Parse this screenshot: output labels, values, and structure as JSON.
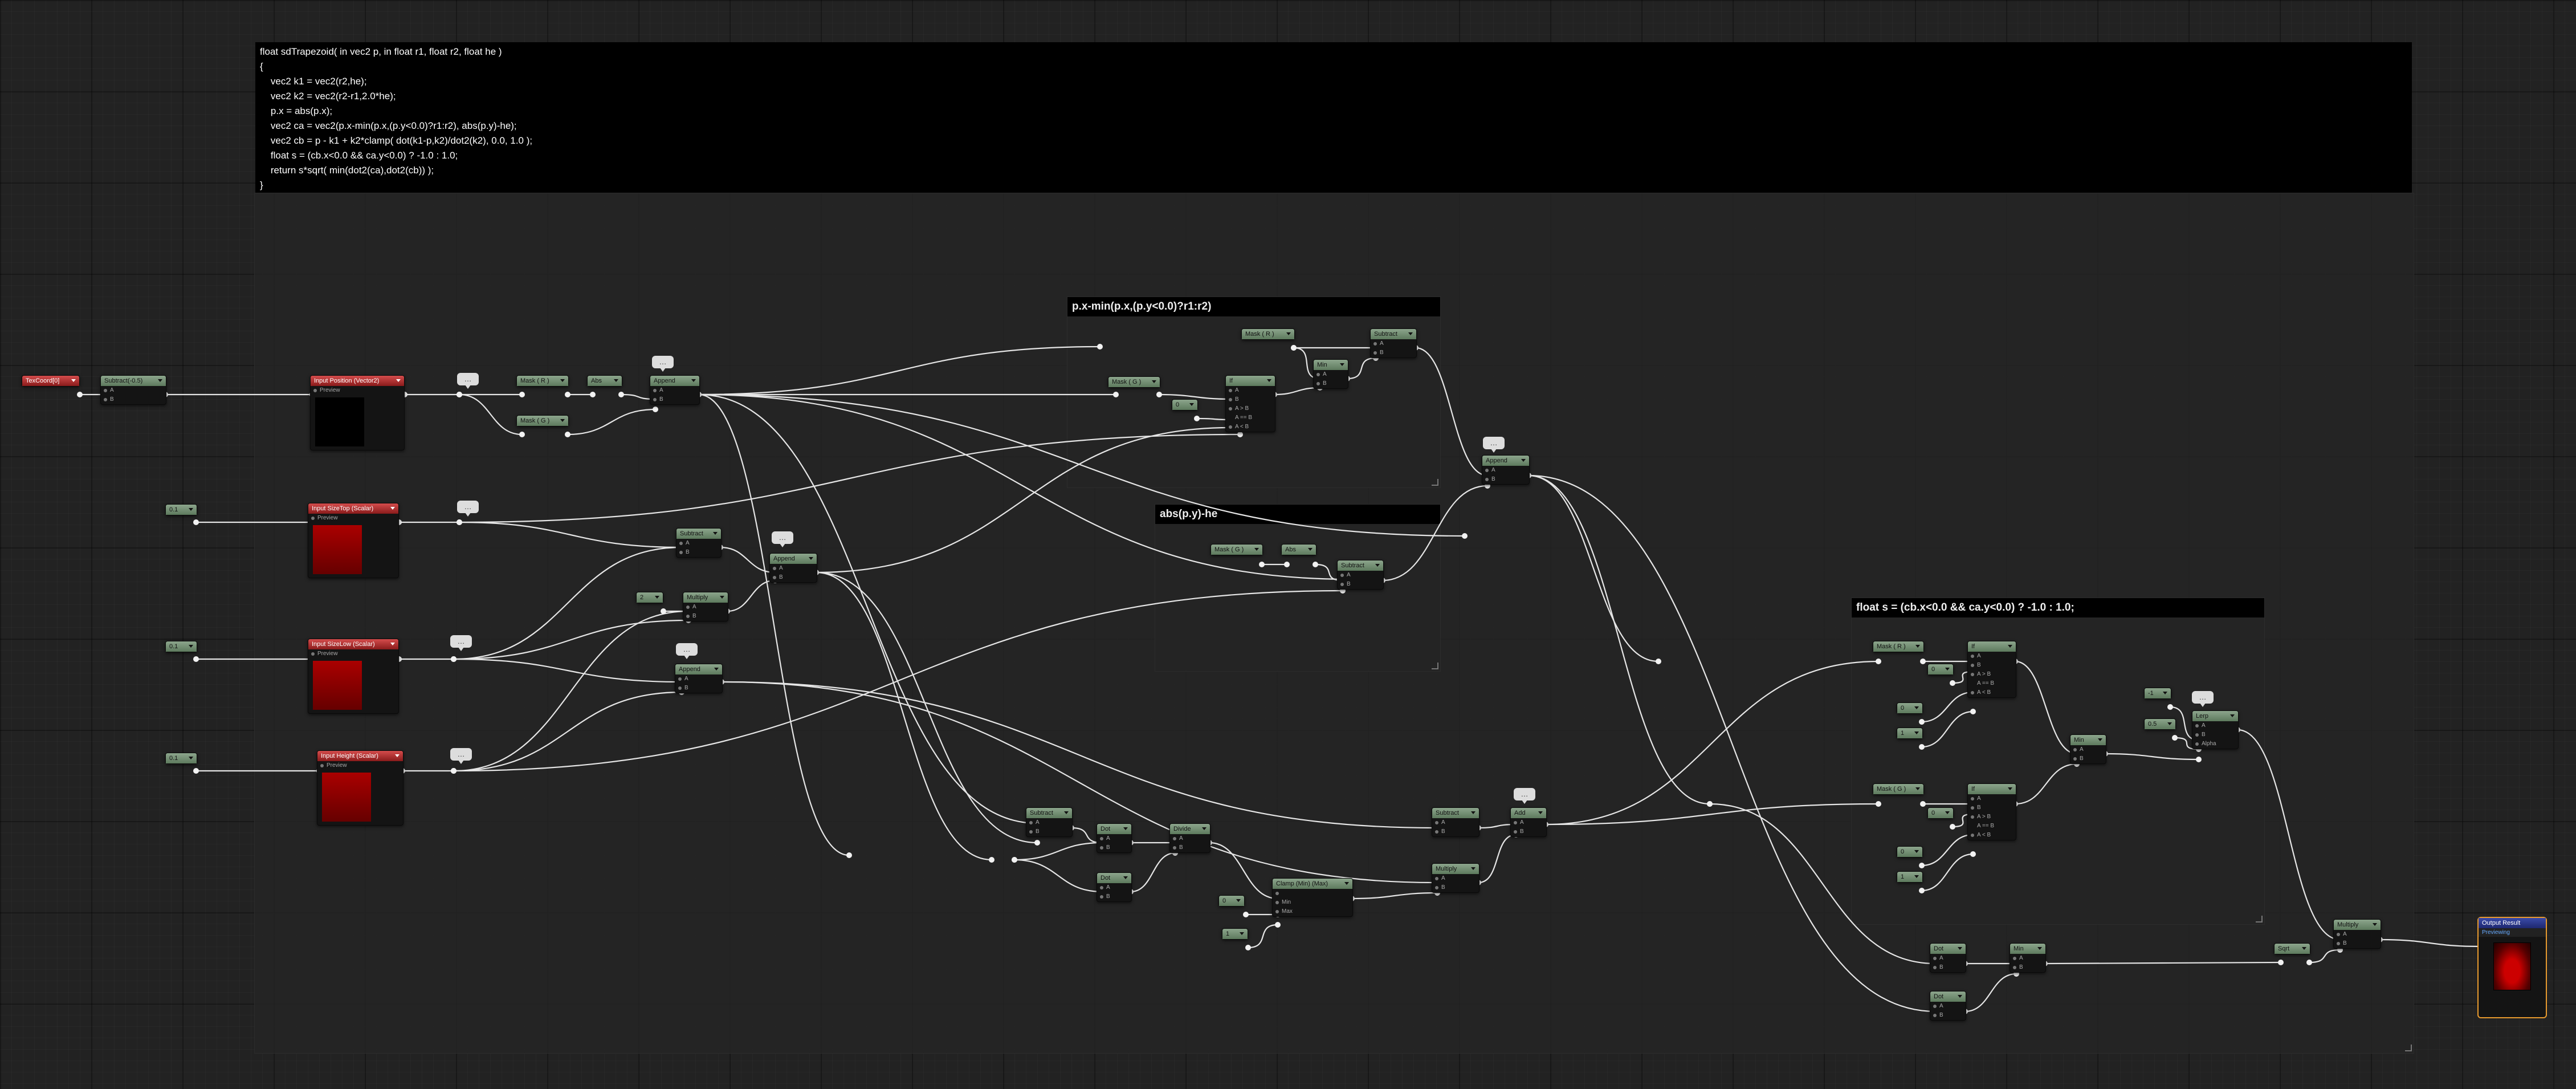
{
  "code_comment": "float sdTrapezoid( in vec2 p, in float r1, float r2, float he )\n{\n    vec2 k1 = vec2(r2,he);\n    vec2 k2 = vec2(r2-r1,2.0*he);\n    p.x = abs(p.x);\n    vec2 ca = vec2(p.x-min(p.x,(p.y<0.0)?r1:r2), abs(p.y)-he);\n    vec2 cb = p - k1 + k2*clamp( dot(k1-p,k2)/dot2(k2), 0.0, 1.0 );\n    float s = (cb.x<0.0 && ca.y<0.0) ? -1.0 : 1.0;\n    return s*sqrt( min(dot2(ca),dot2(cb)) );\n}",
  "comments": {
    "pxmin": "p.x-min(p.x,(p.y<0.0)?r1:r2)",
    "absy": "abs(p.y)-he",
    "sign": "float s = (cb.x<0.0 && ca.y<0.0) ? -1.0 : 1.0;"
  },
  "nodes": {
    "texcoord": "TexCoord[0]",
    "subtract_05": "Subtract(-0.5)",
    "input_position": "Input Position (Vector2)",
    "input_sizetop": "Input SizeTop (Scalar)",
    "input_sizelow": "Input SizeLow (Scalar)",
    "input_height": "Input Height (Scalar)",
    "mask_r1": "Mask ( R )",
    "mask_g1": "Mask ( G )",
    "abs1": "Abs",
    "append1": "Append",
    "const_01a": "0.1",
    "const_01b": "0.1",
    "const_01c": "0.1",
    "subtract_a": "Subtract",
    "multiply_a": "Multiply",
    "const_2": "2",
    "append_b": "Append",
    "append_c": "Append",
    "mask_r2": "Mask ( R )",
    "mask_g2": "Mask ( G )",
    "min1": "Min",
    "if1": "If",
    "const_0a": "0",
    "subtract_b": "Subtract",
    "append_d": "Append",
    "mask_g3": "Mask ( G )",
    "abs2": "Abs",
    "subtract_c": "Subtract",
    "subtract_d": "Subtract",
    "dot1": "Dot",
    "dot2": "Dot",
    "divide": "Divide",
    "clamp": "Clamp (Min) (Max)",
    "const_0b": "0",
    "const_1a": "1",
    "subtract_e": "Subtract",
    "add1": "Add",
    "multiply_b": "Multiply",
    "mask_r3": "Mask ( R )",
    "if2": "If",
    "mask_g4": "Mask ( G )",
    "if3": "If",
    "const_0c": "0",
    "const_0d": "0",
    "const_1b": "1",
    "const_0e": "0",
    "const_0f": "0",
    "const_1c": "1",
    "min2": "Min",
    "const_m1": "-1",
    "const_1d": "0.5",
    "lerp": "Lerp",
    "dot3": "Dot",
    "dot4": "Dot",
    "min3": "Min",
    "sqrt": "Sqrt",
    "multiply_c": "Multiply",
    "output": "Output Result",
    "output_sub": "Previewing"
  },
  "pins": {
    "a": "A",
    "b": "B",
    "preview": "Preview",
    "agb": "A > B",
    "aeb": "A == B",
    "alb": "A < B",
    "min": "Min",
    "max": "Max",
    "alpha": "Alpha"
  }
}
